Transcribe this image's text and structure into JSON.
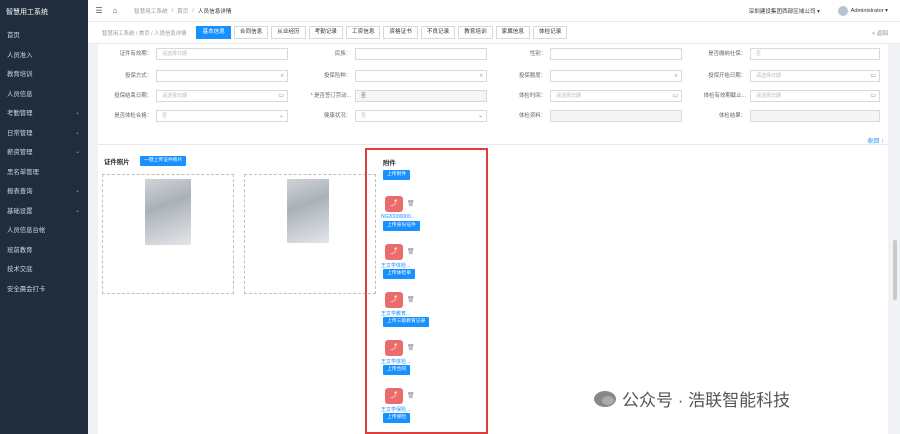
{
  "sidebar": {
    "brand": "智慧用工系统",
    "items": [
      {
        "label": "首页",
        "chevron": false
      },
      {
        "label": "人员准入",
        "chevron": false
      },
      {
        "label": "教育培训",
        "chevron": false
      },
      {
        "label": "人员信息",
        "chevron": false
      },
      {
        "label": "考勤管理",
        "chevron": true
      },
      {
        "label": "日常管理",
        "chevron": true
      },
      {
        "label": "薪资管理",
        "chevron": true
      },
      {
        "label": "黑名单管理",
        "chevron": false
      },
      {
        "label": "报表查询",
        "chevron": true
      },
      {
        "label": "基础设置",
        "chevron": true
      },
      {
        "label": "人员信息台帐",
        "chevron": false
      },
      {
        "label": "班前教育",
        "chevron": false
      },
      {
        "label": "技术交底",
        "chevron": false
      },
      {
        "label": "安全晨会打卡",
        "chevron": false
      }
    ]
  },
  "topbar": {
    "crumbs": [
      "智慧用工系统",
      "/",
      "首页",
      "/",
      "人员信息详情"
    ],
    "org": "深圳建设集团西部区域公司 ▾",
    "user": "Administrator ▾"
  },
  "tabbar": {
    "crumbs": "智慧用工系统 / 首页 / 人员信息详情",
    "tabs": [
      "基本信息",
      "合同信息",
      "从业经历",
      "考勤记录",
      "工资信息",
      "资格证书",
      "不良记录",
      "教育培训",
      "家属信息",
      "体检记录"
    ],
    "active": 0,
    "back": "< 返回"
  },
  "form": {
    "row1": [
      {
        "label": "证件有效期：",
        "value": "请选择日期",
        "suffix": ""
      },
      {
        "label": "民族：",
        "value": "",
        "suffix": ""
      },
      {
        "label": "性别：",
        "value": "",
        "suffix": ""
      },
      {
        "label": "是否缴纳社保：",
        "value": "否",
        "suffix": ""
      }
    ],
    "row2": [
      {
        "label": "投保方式：",
        "value": "",
        "suffix": "⌕"
      },
      {
        "label": "投保险种：",
        "value": "",
        "suffix": "⌕"
      },
      {
        "label": "投保额度：",
        "value": "",
        "suffix": "⌕"
      },
      {
        "label": "投保开始日期：",
        "value": "请选择日期",
        "suffix": "▭"
      }
    ],
    "row3": [
      {
        "label": "投保结束日期：",
        "value": "请选择日期",
        "suffix": "▭"
      },
      {
        "label": "* 是否签订劳动...",
        "value": "否",
        "suffix": "",
        "disabled": true
      },
      {
        "label": "体检时间：",
        "value": "请选择日期",
        "suffix": "▭"
      },
      {
        "label": "体检有效期截止...",
        "value": "请选择日期",
        "suffix": "▭"
      }
    ],
    "row4": [
      {
        "label": "是否体检合格：",
        "value": "否",
        "suffix": "⌄"
      },
      {
        "label": "健康状况：",
        "value": "否",
        "suffix": "⌄"
      },
      {
        "label": "体检资料：",
        "value": "",
        "suffix": "",
        "disabled": true
      },
      {
        "label": "体检结果：",
        "value": "",
        "suffix": "",
        "disabled": true
      }
    ],
    "collapse": "收回 ↑"
  },
  "photos": {
    "title": "证件照片",
    "button": "一键上传证件照片"
  },
  "attachments": {
    "title": "附件",
    "upload_all": "上传附件",
    "items": [
      {
        "name": "NG20000000...",
        "button": "上传身份证件"
      },
      {
        "name": "王文学体检...",
        "button": "上传体检单"
      },
      {
        "name": "王文学教育...",
        "button": "上传三级教育记录"
      },
      {
        "name": "王文学体检...",
        "button": "上传合同"
      },
      {
        "name": "王文学保险...",
        "button": "上传保险"
      }
    ]
  },
  "watermark": "公众号 · 浩联智能科技"
}
